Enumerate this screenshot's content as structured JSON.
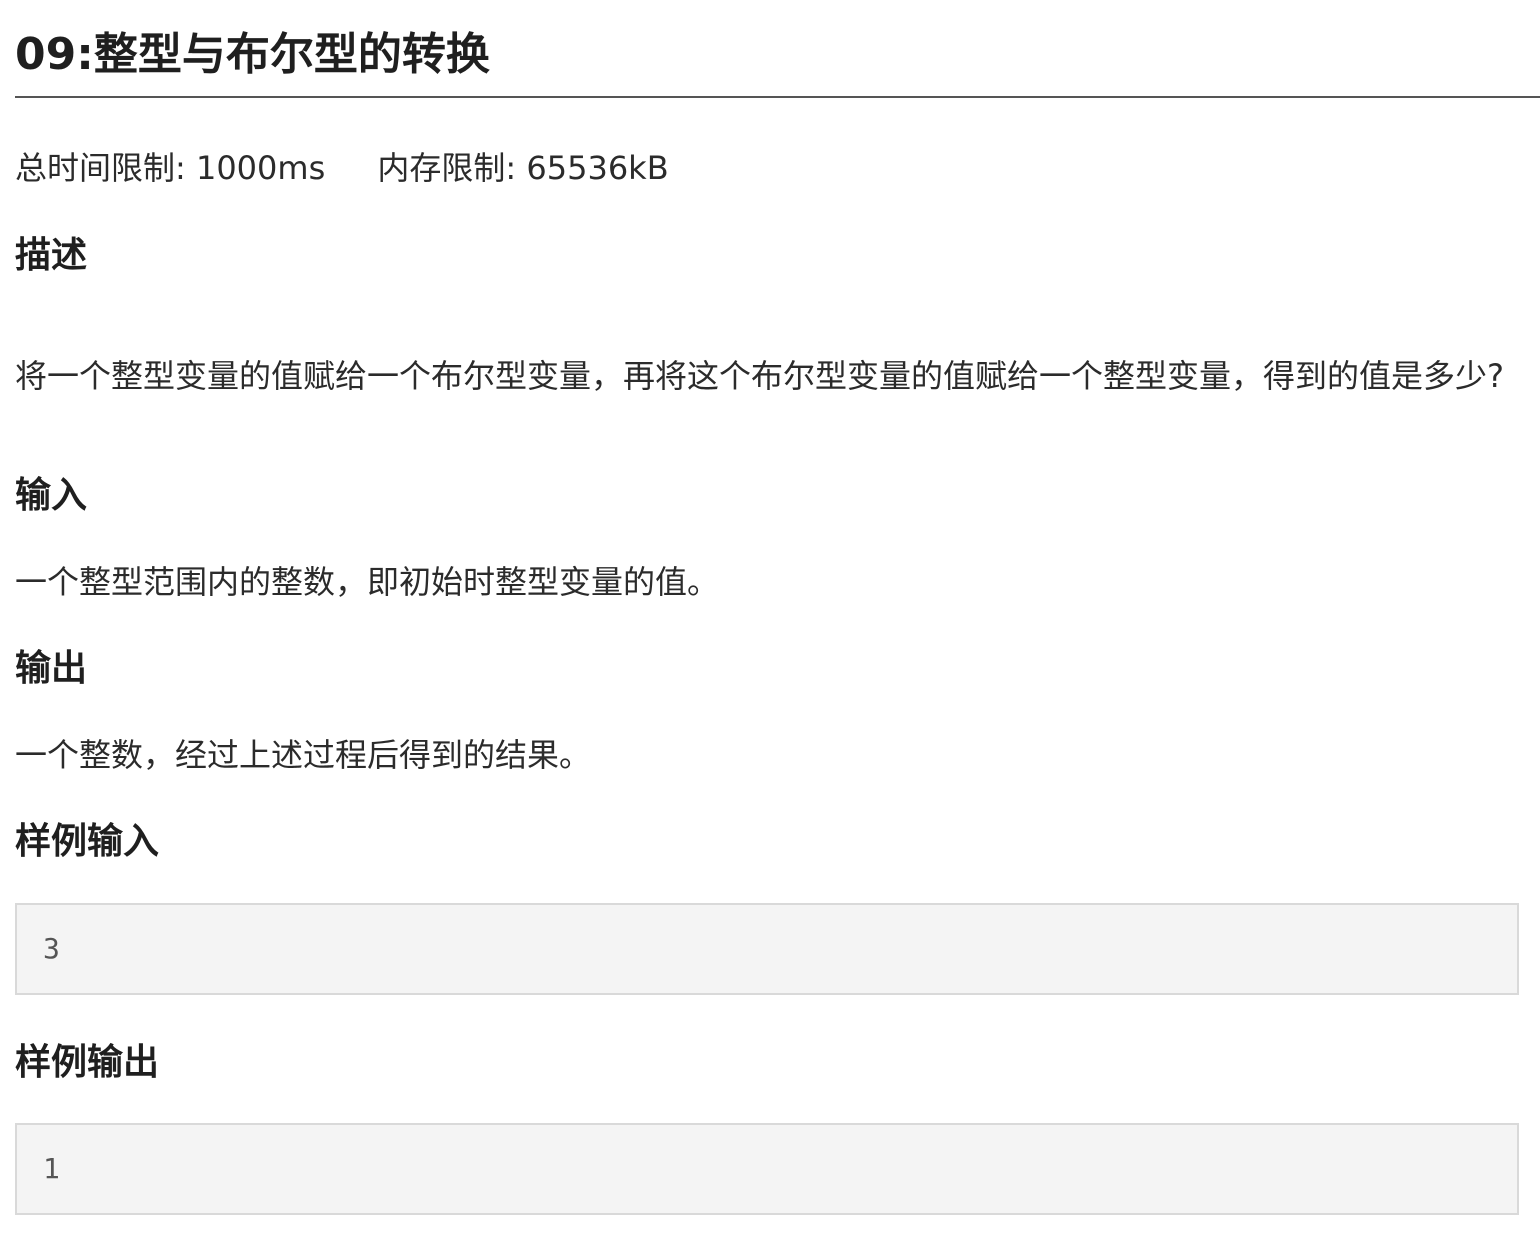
{
  "problem": {
    "title": "09:整型与布尔型的转换",
    "time_limit": "总时间限制: 1000ms",
    "memory_limit": "内存限制: 65536kB"
  },
  "sections": {
    "description": {
      "heading": "描述",
      "text": "将一个整型变量的值赋给一个布尔型变量，再将这个布尔型变量的值赋给一个整型变量，得到的值是多少?"
    },
    "input": {
      "heading": "输入",
      "text": "一个整型范围内的整数，即初始时整型变量的值。"
    },
    "output": {
      "heading": "输出",
      "text": "一个整数，经过上述过程后得到的结果。"
    },
    "sample_input": {
      "heading": "样例输入",
      "value": "3"
    },
    "sample_output": {
      "heading": "样例输出",
      "value": "1"
    }
  }
}
